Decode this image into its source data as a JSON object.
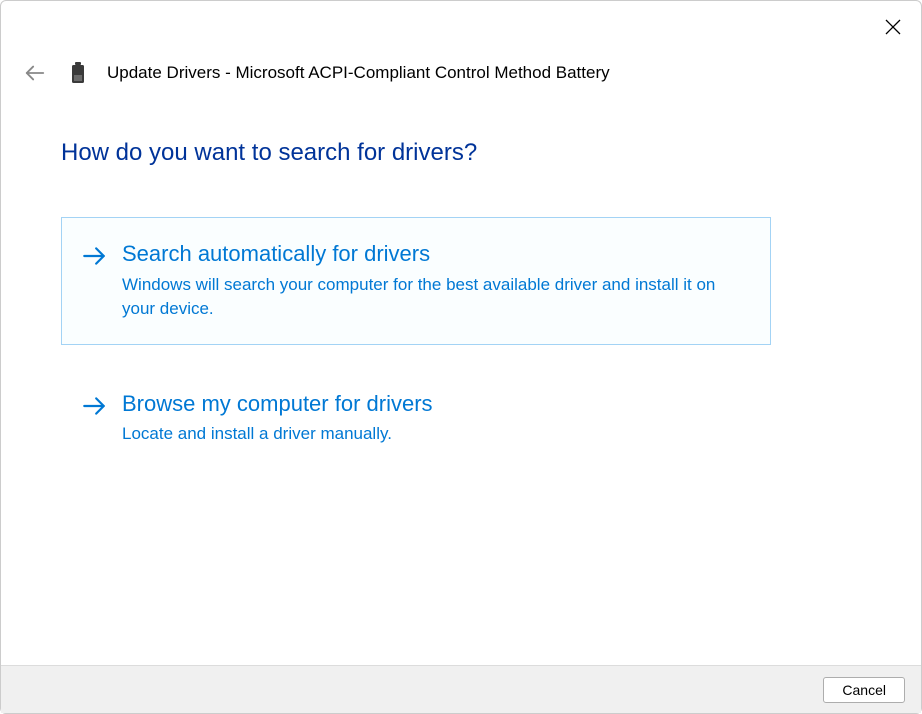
{
  "window": {
    "title": "Update Drivers - Microsoft ACPI-Compliant Control Method Battery"
  },
  "prompt": "How do you want to search for drivers?",
  "options": [
    {
      "title": "Search automatically for drivers",
      "description": "Windows will search your computer for the best available driver and install it on your device."
    },
    {
      "title": "Browse my computer for drivers",
      "description": "Locate and install a driver manually."
    }
  ],
  "footer": {
    "cancel_label": "Cancel"
  },
  "colors": {
    "link": "#0078d4",
    "heading": "#003399",
    "hover_border": "#a3d3f5"
  }
}
